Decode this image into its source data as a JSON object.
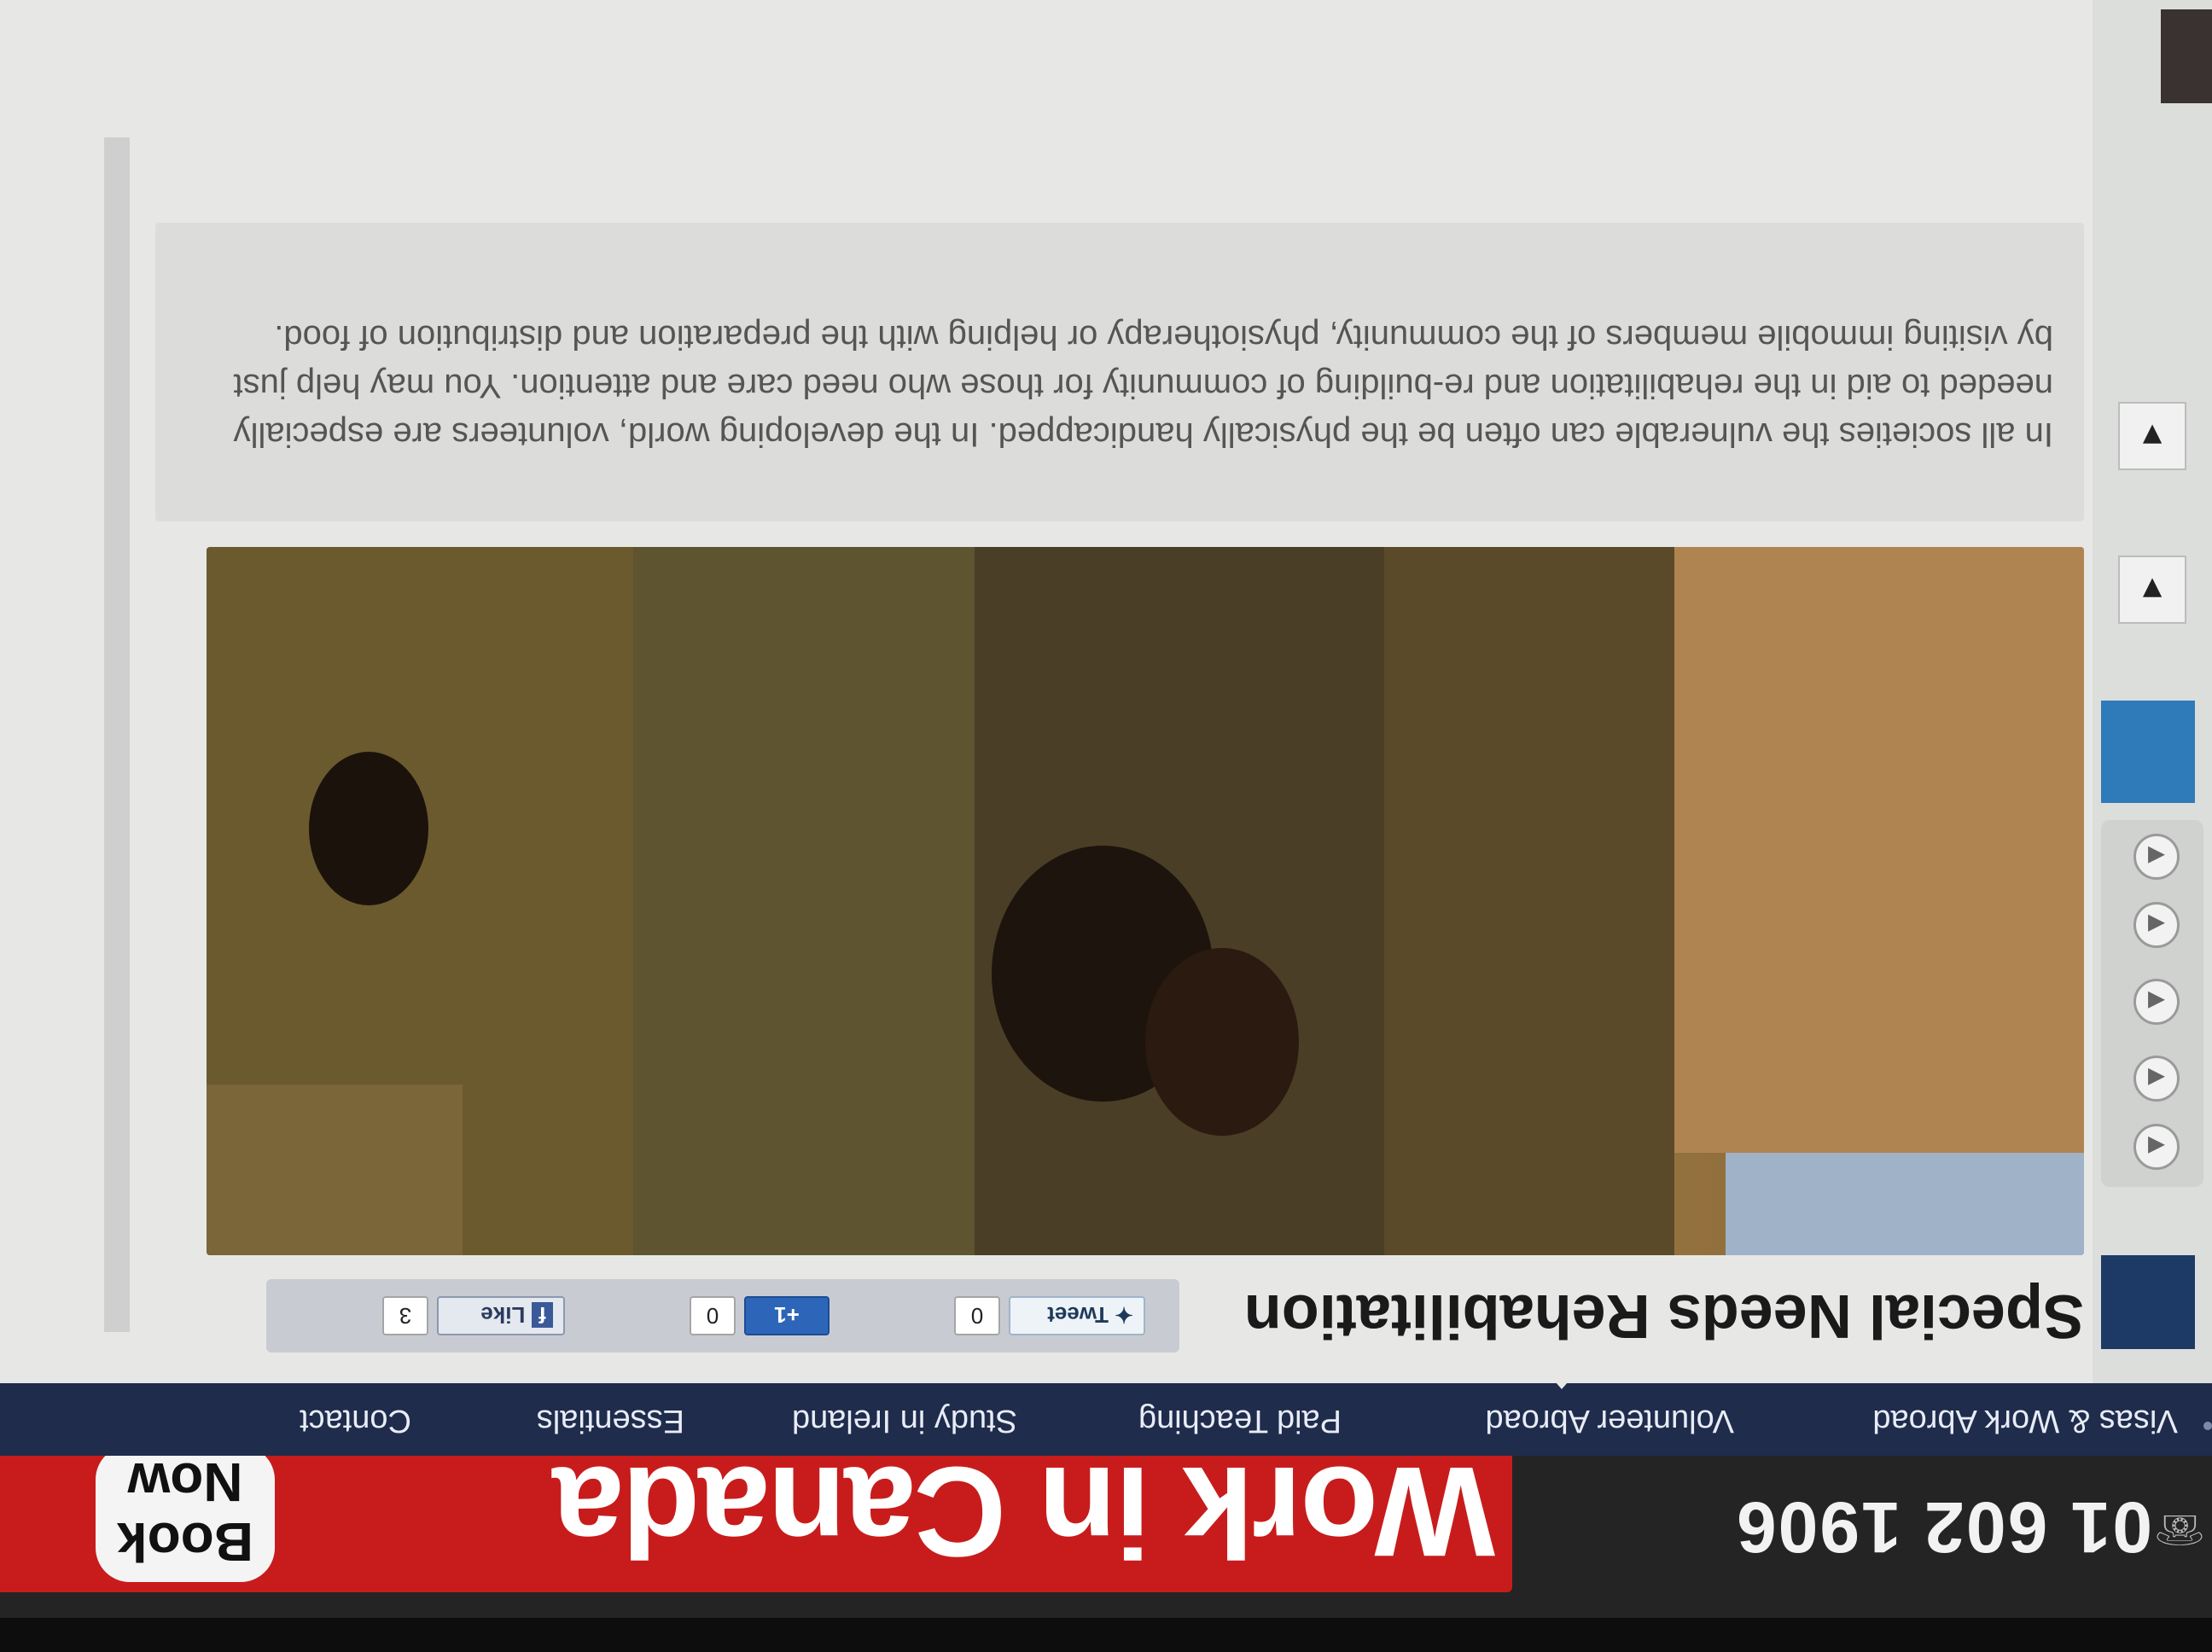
{
  "header": {
    "phone_icon": "phone-icon",
    "phone_number": "01 602 1906",
    "banner_title": "Work in Canada",
    "book_now_line1": "Book",
    "book_now_line2": "Now"
  },
  "nav": {
    "items": [
      {
        "label": "Visas & Work Abroad"
      },
      {
        "label": "Volunteer Abroad"
      },
      {
        "label": "Paid Teaching"
      },
      {
        "label": "Study in Ireland"
      },
      {
        "label": "Essentials"
      },
      {
        "label": "Contact"
      }
    ],
    "active_index": 1
  },
  "article": {
    "title": "Special Needs Rehabilitation",
    "description": "In all societies the vulnerable can often be the physically handicapped.  In the developing world, volunteers are especially needed to aid in the rehabilitation and re-building of community for those who need care and attention.  You may help just by visiting immobile members of the community, physiotherapy or helping with the preparation and distribution of food."
  },
  "share": {
    "tweet_label": "Tweet",
    "tweet_count": "0",
    "plusone_label": "+1",
    "plusone_count": "0",
    "like_label": "Like",
    "like_count": "3"
  },
  "colors": {
    "banner": "#c81c1c",
    "nav_bg": "#1f2c4c",
    "page_bg": "#e7e8e5"
  }
}
